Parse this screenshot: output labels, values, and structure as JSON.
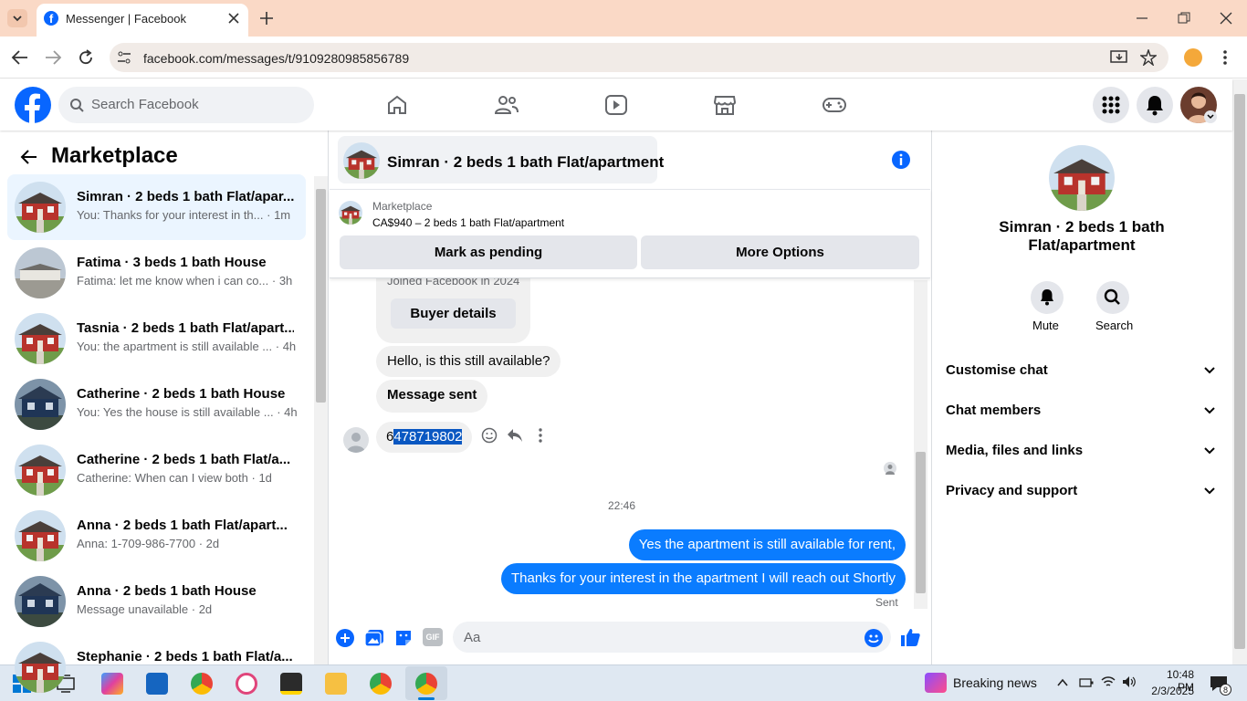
{
  "browser": {
    "tab_title": "Messenger | Facebook",
    "url": "facebook.com/messages/t/9109280985856789"
  },
  "fb_header": {
    "search_placeholder": "Search Facebook"
  },
  "left_panel": {
    "title": "Marketplace",
    "conversations": [
      {
        "title": "Simran · 2 beds 1 bath Flat/apar...",
        "snippet": "You: Thanks for your interest in th...",
        "time": "· 1m",
        "active": true,
        "thumb": "red-house"
      },
      {
        "title": "Fatima · 3 beds 1 bath House",
        "snippet": "Fatima: let me know when i can co...",
        "time": "· 3h",
        "thumb": "grey-house"
      },
      {
        "title": "Tasnia · 2 beds 1 bath Flat/apart...",
        "snippet": "You: the apartment is still available ...",
        "time": "· 4h",
        "thumb": "red-house"
      },
      {
        "title": "Catherine · 2 beds 1 bath House",
        "snippet": "You: Yes the house is still available ...",
        "time": "· 4h",
        "thumb": "blue-house"
      },
      {
        "title": "Catherine · 2 beds 1 bath Flat/a...",
        "snippet": "Catherine: When can I view both",
        "time": "· 1d",
        "thumb": "red-house"
      },
      {
        "title": "Anna · 2 beds 1 bath Flat/apart...",
        "snippet": "Anna: 1-709-986-7700",
        "time": "· 2d",
        "thumb": "red-house"
      },
      {
        "title": "Anna · 2 beds 1 bath House",
        "snippet": "Message unavailable",
        "time": "· 2d",
        "thumb": "blue-house"
      },
      {
        "title": "Stephanie · 2 beds 1 bath Flat/a...",
        "snippet": "",
        "time": "",
        "thumb": "red-house"
      }
    ]
  },
  "chat": {
    "title": "Simran · 2 beds 1 bath Flat/apartment",
    "listing_label": "Marketplace",
    "listing_price_title": "CA$940 – 2 beds 1 bath Flat/apartment",
    "btn_pending": "Mark as pending",
    "btn_more": "More Options",
    "joined_text": "Joined Facebook in 2024",
    "buyer_details": "Buyer details",
    "msg_available": "Hello, is this still available?",
    "msg_sent": "Message sent",
    "phone_first": "6",
    "phone_selected": "478719802",
    "timestamp": "22:46",
    "out_msg_1": "Yes the apartment is still available for rent,",
    "out_msg_2": "Thanks for your interest in the apartment I will reach out Shortly",
    "sent_status": "Sent",
    "composer_placeholder": "Aa"
  },
  "right_panel": {
    "name": "Simran · 2 beds 1 bath Flat/apartment",
    "mute_label": "Mute",
    "search_label": "Search",
    "sections": [
      "Customise chat",
      "Chat members",
      "Media, files and links",
      "Privacy and support"
    ]
  },
  "taskbar": {
    "news_label": "Breaking news",
    "time": "10:48 PM",
    "date": "2/3/2025",
    "notif_count": "8"
  },
  "colors": {
    "fb_blue": "#0866ff",
    "messenger_blue": "#0a7cff",
    "tab_bar": "#fad9c6"
  }
}
